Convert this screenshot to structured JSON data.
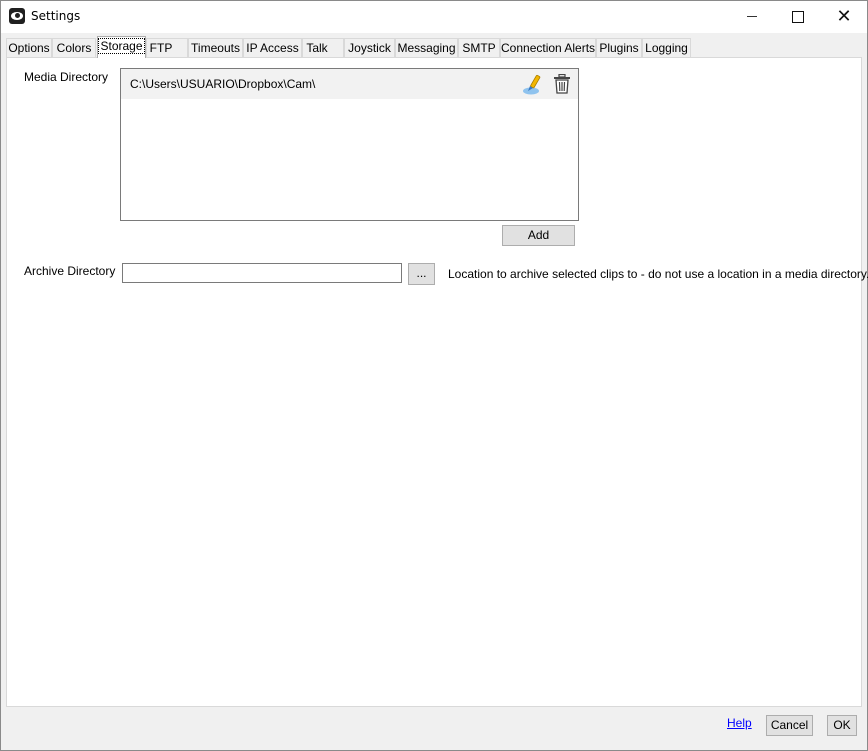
{
  "window": {
    "title": "Settings",
    "close_glyph": "✕"
  },
  "tabs": [
    {
      "label": "Options"
    },
    {
      "label": "Colors"
    },
    {
      "label": "Storage",
      "active": true
    },
    {
      "label": "FTP"
    },
    {
      "label": "Timeouts"
    },
    {
      "label": "IP Access"
    },
    {
      "label": "Talk"
    },
    {
      "label": "Joystick"
    },
    {
      "label": "Messaging"
    },
    {
      "label": "SMTP"
    },
    {
      "label": "Connection Alerts"
    },
    {
      "label": "Plugins"
    },
    {
      "label": "Logging"
    }
  ],
  "storage": {
    "media_directory_label": "Media Directory",
    "media_directories": [
      {
        "path": "C:\\Users\\USUARIO\\Dropbox\\Cam\\"
      }
    ],
    "add_label": "Add",
    "archive_directory_label": "Archive Directory",
    "archive_directory_value": "",
    "browse_label": "...",
    "archive_hint": "Location to archive selected clips to - do not use a location in a media directory."
  },
  "footer": {
    "help_label": "Help",
    "cancel_label": "Cancel",
    "ok_label": "OK"
  },
  "icons": {
    "edit": "edit-icon",
    "delete": "trash-icon",
    "app": "eye-icon"
  }
}
